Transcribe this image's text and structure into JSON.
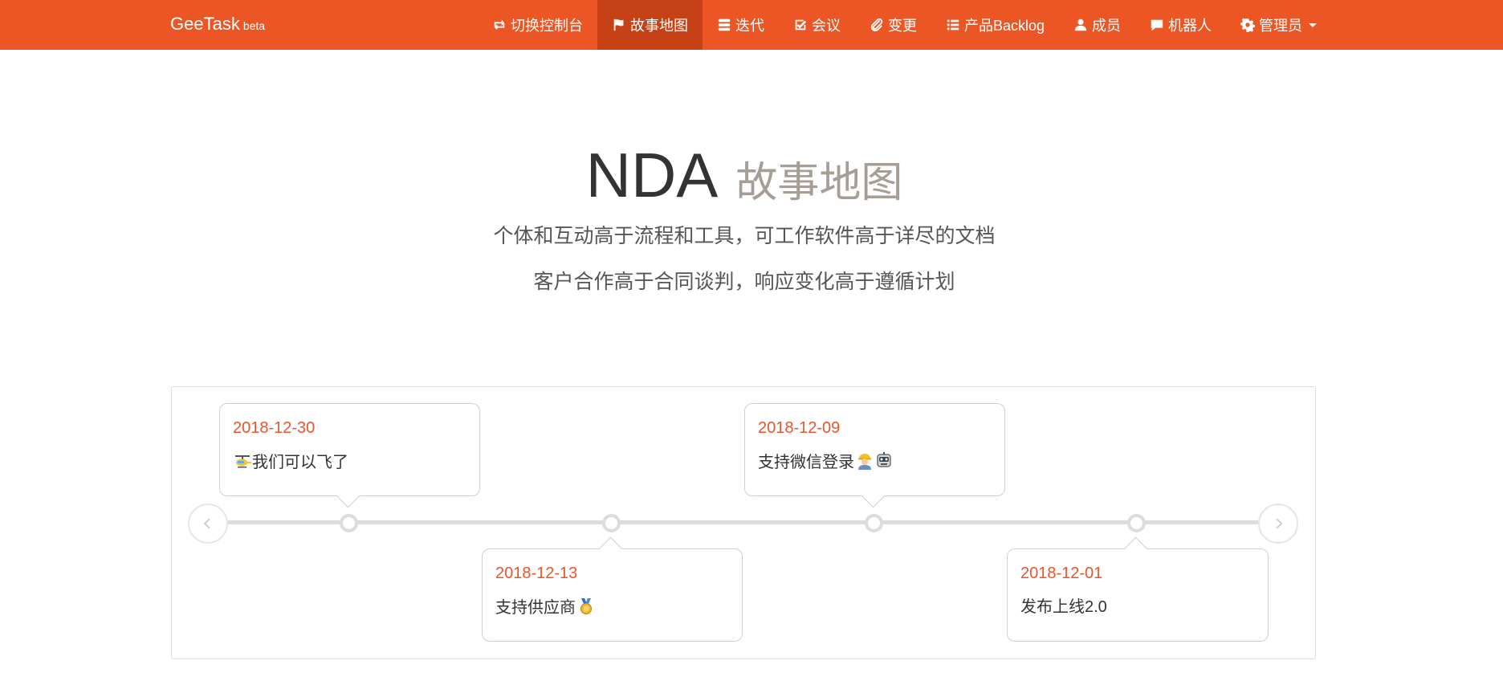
{
  "brand": {
    "name": "GeeTask",
    "tag": "beta"
  },
  "nav": [
    {
      "label": "切换控制台",
      "icon": "retweet-icon"
    },
    {
      "label": "故事地图",
      "icon": "flag-icon"
    },
    {
      "label": "迭代",
      "icon": "server-icon"
    },
    {
      "label": "会议",
      "icon": "check-square-icon"
    },
    {
      "label": "变更",
      "icon": "paperclip-icon"
    },
    {
      "label": "产品Backlog",
      "icon": "list-icon"
    },
    {
      "label": "成员",
      "icon": "user-icon"
    },
    {
      "label": "机器人",
      "icon": "comment-icon"
    },
    {
      "label": "管理员",
      "icon": "gear-icon"
    }
  ],
  "colors": {
    "accent": "#ec5625",
    "active": "#c64116",
    "date": "#e9552b",
    "subtitle": "#a69e95"
  },
  "hero": {
    "project": "NDA",
    "subtitle": "故事地图",
    "motto1": "个体和互动高于流程和工具，可工作软件高于详尽的文档",
    "motto2": "客户合作高于合同谈判，响应变化高于遵循计划"
  },
  "timeline": [
    {
      "date": "2018-12-30",
      "text": "我们可以飞了",
      "emoji": [
        "helicopter-emoji"
      ]
    },
    {
      "date": "2018-12-13",
      "text": "支持供应商",
      "emoji": [
        "medal-emoji"
      ]
    },
    {
      "date": "2018-12-09",
      "text": "支持微信登录",
      "emoji": [
        "worker-emoji",
        "robot-emoji"
      ]
    },
    {
      "date": "2018-12-01",
      "text": "发布上线2.0",
      "emoji": []
    }
  ]
}
